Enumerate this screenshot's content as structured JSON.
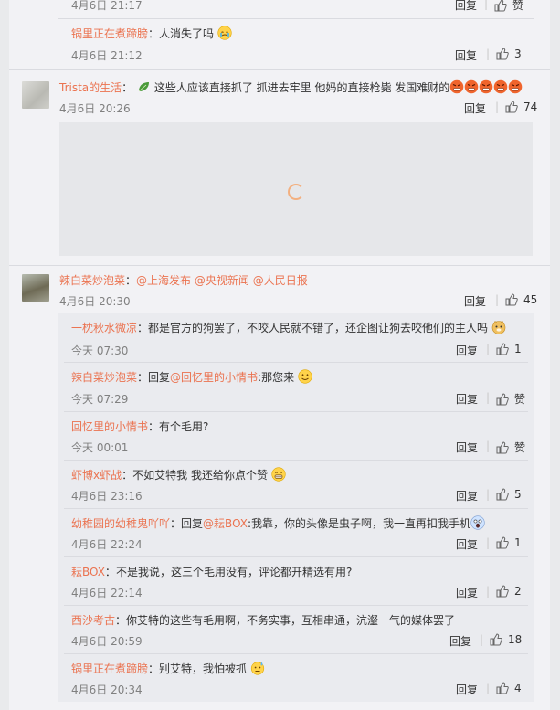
{
  "top_partial": {
    "time": "4月6日 21:17",
    "reply": "回复",
    "like": "赞"
  },
  "comments": [
    {
      "id": "c1",
      "name": "锅里正在煮蹄膀",
      "text": "人消失了吗",
      "emoji": "crying-face",
      "time": "4月6日 21:12",
      "reply": "回复",
      "likes": "3"
    },
    {
      "id": "c2",
      "name": "Trista的生活",
      "text": "这些人应该直接抓了 抓进去牢里 他妈的直接枪毙 发国难财的",
      "emoji": "angry-face",
      "time": "4月6日 20:26",
      "reply": "回复",
      "likes": "74"
    },
    {
      "id": "c3",
      "name": "辣白菜炒泡菜",
      "mentions": [
        "@上海发布",
        "@央视新闻",
        "@人民日报"
      ],
      "time": "4月6日 20:30",
      "reply": "回复",
      "likes": "45"
    }
  ],
  "replies": [
    {
      "name": "一枕秋水微凉",
      "text": "都是官方的狗罢了，不咬人民就不错了，还企图让狗去咬他们的主人吗",
      "emoji": "doge-icon",
      "time": "今天 07:30",
      "reply": "回复",
      "likes": "1"
    },
    {
      "name": "辣白菜炒泡菜",
      "prefix": "回复",
      "mention": "@回忆里的小情书",
      "text": ":那您来",
      "emoji": "smile-face",
      "time": "今天 07:29",
      "reply": "回复",
      "likes": "赞"
    },
    {
      "name": "回忆里的小情书",
      "text": "有个毛用?",
      "time": "今天 00:01",
      "reply": "回复",
      "likes": "赞"
    },
    {
      "name": "虾博x虾战",
      "text": "不如艾特我 我还给你点个赞",
      "emoji": "grin-face",
      "time": "4月6日 23:16",
      "reply": "回复",
      "likes": "5"
    },
    {
      "name": "幼稚园的幼稚鬼吖吖",
      "prefix": "回复",
      "mention": "@耘BOX",
      "text": ":我靠，你的头像是虫子啊，我一直再扣我手机",
      "emoji": "scared-face",
      "time": "4月6日 22:24",
      "reply": "回复",
      "likes": "1"
    },
    {
      "name": "耘BOX",
      "text": "不是我说，这三个毛用没有，评论都开精选有用?",
      "time": "4月6日 22:14",
      "reply": "回复",
      "likes": "2"
    },
    {
      "name": "西沙考古",
      "text": "你艾特的这些有毛用啊，不务实事，互相串通，沆瀣一气的媒体罢了",
      "time": "4月6日 20:59",
      "reply": "回复",
      "likes": "18"
    },
    {
      "name": "锅里正在煮蹄膀",
      "text": "别艾特，我怕被抓",
      "emoji": "sweat-face",
      "time": "4月6日 20:34",
      "reply": "回复",
      "likes": "4"
    }
  ]
}
